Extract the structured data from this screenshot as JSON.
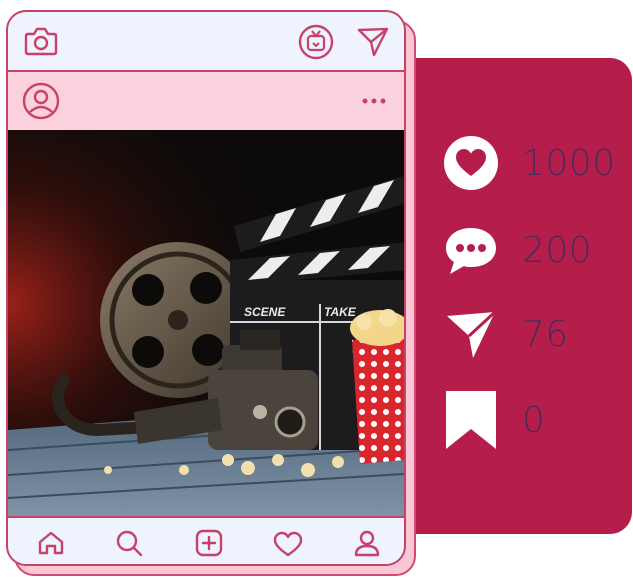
{
  "colors": {
    "brand": "#b51e4b",
    "frame_bg": "#eef3fd",
    "profile_bg": "#fbd1dd",
    "accent_text": "#4a2c5a"
  },
  "top_bar": {
    "icons": [
      "camera-icon",
      "igtv-icon",
      "send-icon"
    ]
  },
  "profile_bar": {
    "icons": [
      "avatar-icon",
      "more-options-icon"
    ]
  },
  "bottom_bar": {
    "icons": [
      "home-icon",
      "search-icon",
      "add-post-icon",
      "activity-heart-icon",
      "profile-icon"
    ]
  },
  "stats": [
    {
      "icon": "heart-icon",
      "value": "1000"
    },
    {
      "icon": "comment-icon",
      "value": "200"
    },
    {
      "icon": "share-icon",
      "value": "76"
    },
    {
      "icon": "bookmark-icon",
      "value": "0"
    }
  ]
}
